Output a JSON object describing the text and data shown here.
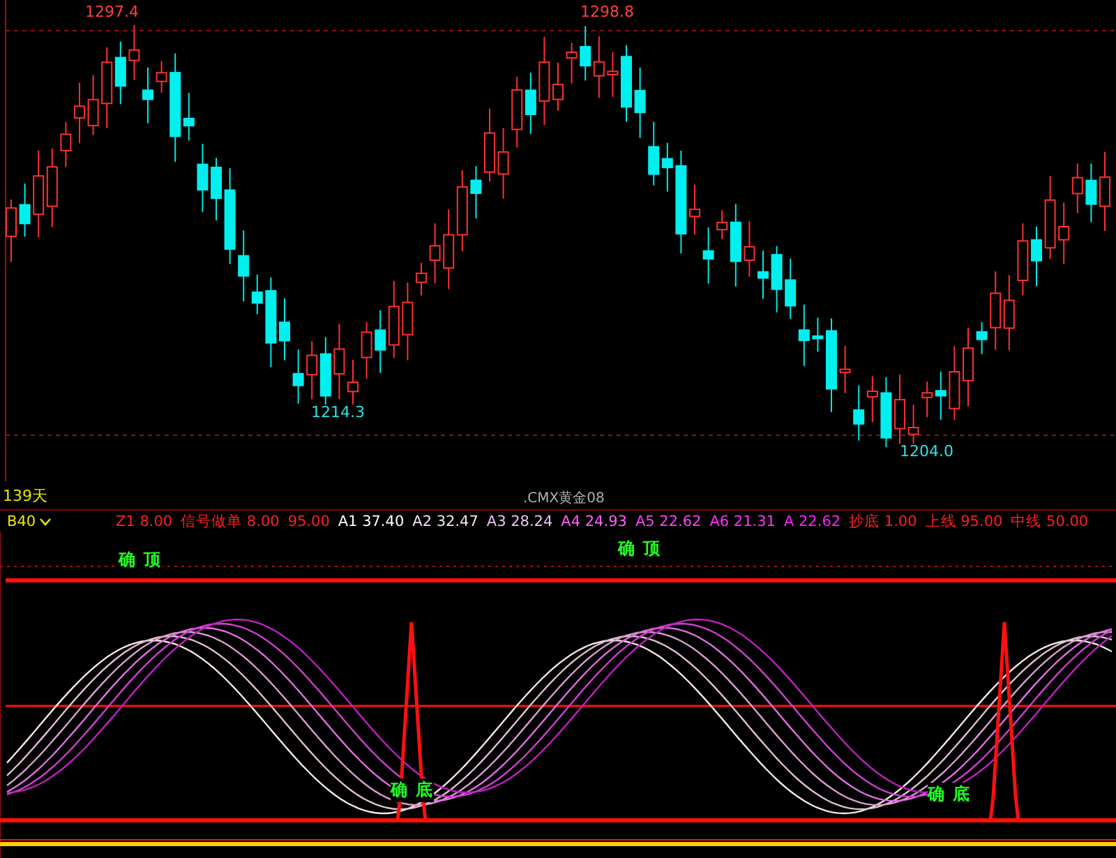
{
  "price_chart": {
    "marks": [
      {
        "text": "1297.4",
        "kind": "high"
      },
      {
        "text": "1214.3",
        "kind": "low"
      },
      {
        "text": "1298.8",
        "kind": "high"
      },
      {
        "text": "1204.0",
        "kind": "low"
      }
    ]
  },
  "period_label": "139天",
  "instrument": ".CMX黄金08",
  "indicator": {
    "name": "B40",
    "params": [
      {
        "text": "Z1 8.00",
        "color": "#ff2020"
      },
      {
        "text": "信号做单 8.00",
        "color": "#ff2020"
      },
      {
        "text": "95.00",
        "color": "#ff2020"
      },
      {
        "text": "A1 37.40",
        "color": "#ffffff"
      },
      {
        "text": "A2 32.47",
        "color": "#f0e0f0"
      },
      {
        "text": "A3 28.24",
        "color": "#e8c0f0"
      },
      {
        "text": "A4 24.93",
        "color": "#ff60ff"
      },
      {
        "text": "A5 22.62",
        "color": "#ff40ff"
      },
      {
        "text": "A6 21.31",
        "color": "#ff30ff"
      },
      {
        "text": "A 22.62",
        "color": "#ff20ff"
      },
      {
        "text": "抄底 1.00",
        "color": "#ff2020"
      },
      {
        "text": "上线 95.00",
        "color": "#ff2020"
      },
      {
        "text": "中线 50.00",
        "color": "#ff2020"
      }
    ]
  },
  "signals": [
    {
      "text": "确 顶",
      "kind": "top"
    },
    {
      "text": "确 顶",
      "kind": "top"
    },
    {
      "text": "确 底",
      "kind": "bottom"
    },
    {
      "text": "确 底",
      "kind": "bottom"
    }
  ]
}
